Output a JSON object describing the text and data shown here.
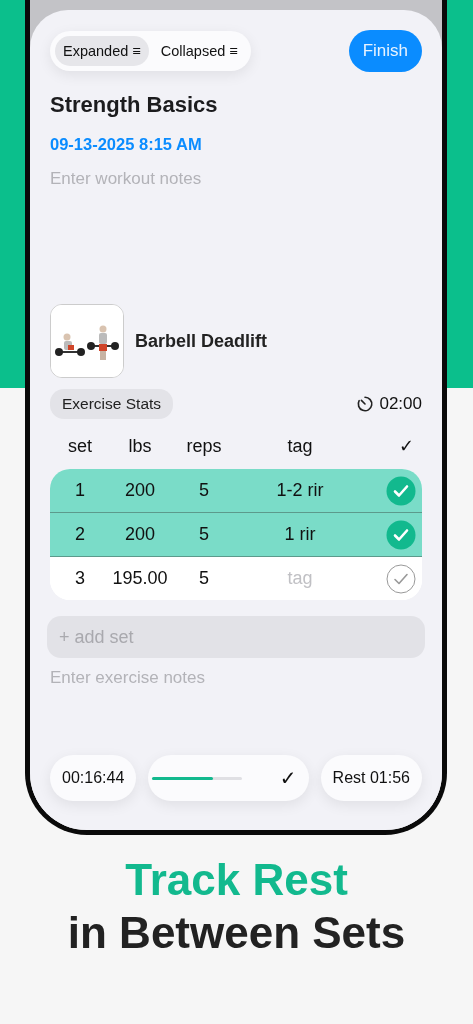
{
  "segmented": [
    {
      "label": "Expanded ≡",
      "selected": true
    },
    {
      "label": "Collapsed ≡",
      "selected": false
    }
  ],
  "finish_button": "Finish",
  "workout": {
    "title": "Strength Basics",
    "date": "09-13-2025 8:15 AM",
    "notes_placeholder": "Enter workout notes"
  },
  "exercise": {
    "name": "Barbell Deadlift",
    "stats_button": "Exercise Stats",
    "rest_timer": "02:00",
    "columns": [
      "set",
      "lbs",
      "reps",
      "tag",
      "✓"
    ],
    "sets": [
      {
        "set": "1",
        "lbs": "200",
        "reps": "5",
        "tag": "1-2 rir",
        "done": true
      },
      {
        "set": "2",
        "lbs": "200",
        "reps": "5",
        "tag": "1 rir",
        "done": true
      },
      {
        "set": "3",
        "lbs": "195.00",
        "reps": "5",
        "tag_placeholder": "tag",
        "done": false
      }
    ],
    "add_set_placeholder": "+ add set",
    "notes_placeholder": "Enter exercise notes"
  },
  "bottom_bar": {
    "elapsed": "00:16:44",
    "progress": {
      "level": 0.67
    },
    "check": "✓",
    "rest": "Rest 01:56"
  },
  "headline": {
    "highlight": "Track Rest",
    "rest": "in Between Sets"
  }
}
